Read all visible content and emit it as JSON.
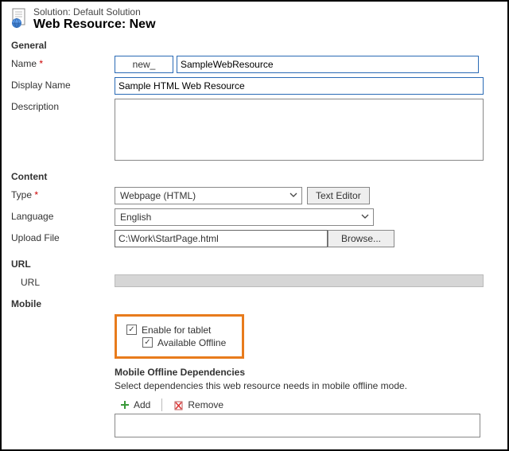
{
  "header": {
    "solution_label": "Solution: Default Solution",
    "title": "Web Resource: New"
  },
  "sections": {
    "general": "General",
    "content": "Content",
    "url": "URL",
    "mobile": "Mobile"
  },
  "general": {
    "name_label": "Name",
    "name_prefix": "new_",
    "name_value": "SampleWebResource",
    "display_label": "Display Name",
    "display_value": "Sample HTML Web Resource",
    "desc_label": "Description",
    "desc_value": ""
  },
  "content": {
    "type_label": "Type",
    "type_value": "Webpage (HTML)",
    "text_editor_btn": "Text Editor",
    "lang_label": "Language",
    "lang_value": "English",
    "upload_label": "Upload File",
    "upload_path": "C:\\Work\\StartPage.html",
    "browse_btn": "Browse..."
  },
  "url": {
    "label": "URL",
    "value": ""
  },
  "mobile": {
    "enable_tablet": "Enable for tablet",
    "available_offline": "Available Offline",
    "deps_head": "Mobile Offline Dependencies",
    "deps_hint": "Select dependencies this web resource needs in mobile offline mode.",
    "add_btn": "Add",
    "remove_btn": "Remove"
  }
}
